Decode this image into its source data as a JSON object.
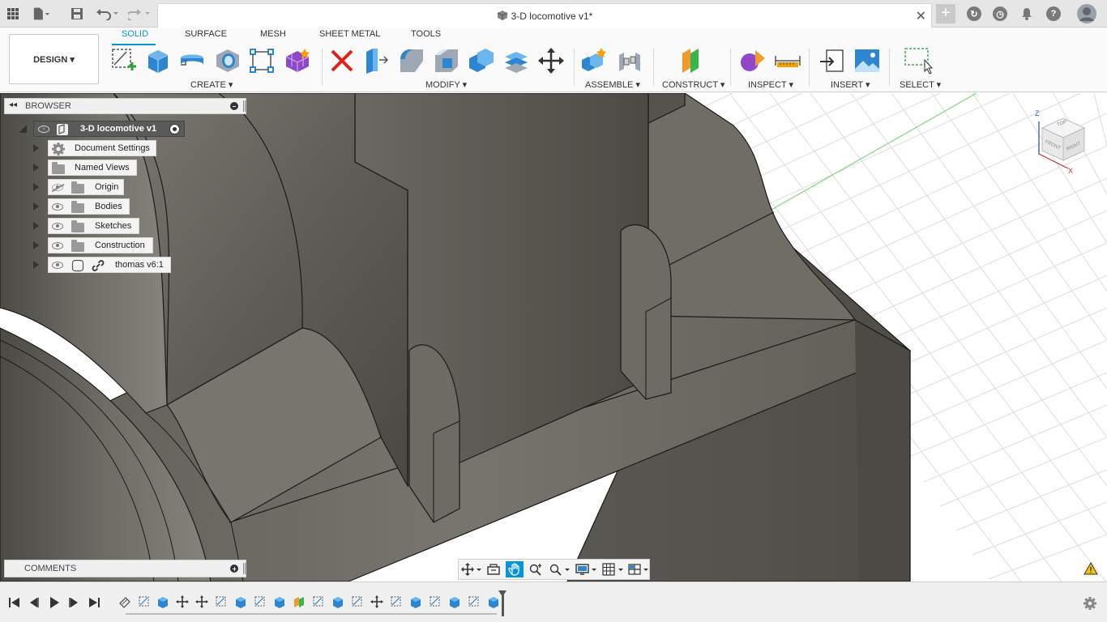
{
  "title_bar": {
    "document_title": "3-D locomotive v1*",
    "icons": [
      "grid-menu-icon",
      "file-icon",
      "save-icon",
      "undo-icon",
      "redo-icon",
      "close-icon",
      "plus-icon",
      "refresh-icon",
      "clock-icon",
      "bell-icon",
      "help-icon",
      "avatar-icon"
    ],
    "help_glyph": "?"
  },
  "ribbon": {
    "workspace_label": "DESIGN ▾",
    "tabs": [
      "SOLID",
      "SURFACE",
      "MESH",
      "SHEET METAL",
      "TOOLS"
    ],
    "active_tab": "SOLID",
    "groups": {
      "create": "CREATE ▾",
      "modify": "MODIFY ▾",
      "assemble": "ASSEMBLE ▾",
      "construct": "CONSTRUCT ▾",
      "inspect": "INSPECT ▾",
      "insert": "INSERT ▾",
      "select": "SELECT ▾"
    },
    "accent": "#0696d7"
  },
  "browser": {
    "header": "BROWSER",
    "root": "3-D locomotive v1",
    "items": [
      {
        "label": "Document Settings"
      },
      {
        "label": "Named Views"
      },
      {
        "label": "Origin"
      },
      {
        "label": "Bodies"
      },
      {
        "label": "Sketches"
      },
      {
        "label": "Construction"
      },
      {
        "label": "thomas v6:1"
      }
    ]
  },
  "comments": {
    "label": "COMMENTS"
  },
  "viewcube": {
    "top": "TOP",
    "front": "FRONT",
    "right": "RIGHT",
    "axis_x": "X",
    "axis_z": "Z"
  },
  "colors": {
    "body_dark": "#55534c",
    "body_mid": "#6f6d66",
    "body_light": "#8a8880",
    "grid": "#dcdcdc",
    "accent": "#0696d7"
  }
}
